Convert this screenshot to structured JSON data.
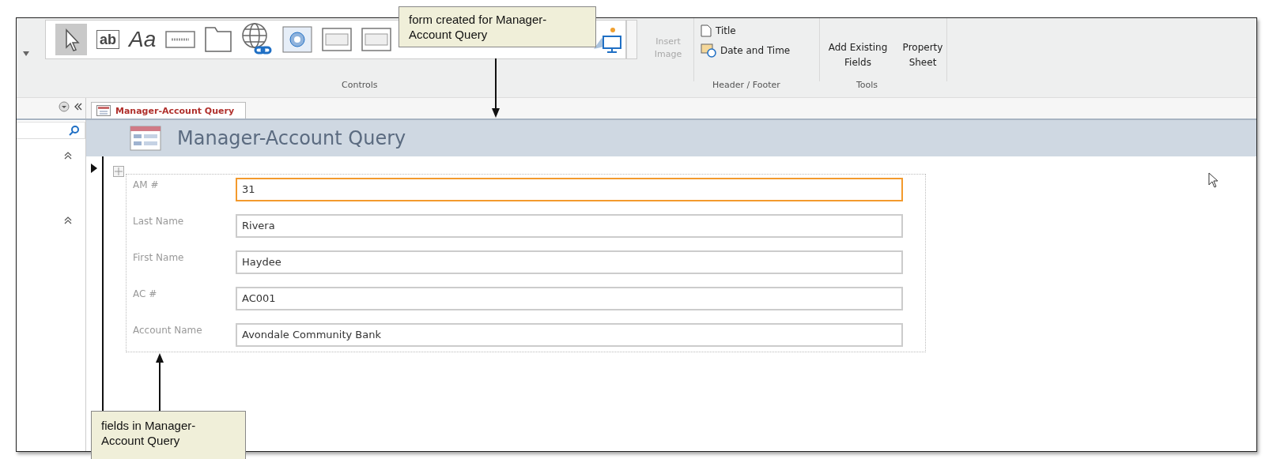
{
  "ribbon": {
    "controls_gallery": [
      {
        "kind": "pointer"
      },
      {
        "kind": "textbox",
        "glyph": "ab"
      },
      {
        "kind": "label",
        "glyph": "Aa"
      },
      {
        "kind": "button"
      },
      {
        "kind": "tab"
      },
      {
        "kind": "hyperlink"
      },
      {
        "kind": "browser"
      },
      {
        "kind": "navigation"
      },
      {
        "kind": "navigation"
      },
      {
        "kind": "image"
      }
    ],
    "insert_image": {
      "label": "Insert Image",
      "disabled": true
    },
    "groups": [
      {
        "label": "Controls"
      },
      {
        "label": "Header / Footer",
        "items": [
          {
            "kind": "title",
            "label": "Title"
          },
          {
            "kind": "datetime",
            "label": "Date and Time"
          }
        ]
      },
      {
        "label": "Tools",
        "items": [
          {
            "kind": "fields",
            "label": "Add Existing Fields"
          },
          {
            "kind": "sheet",
            "label": "Property Sheet"
          }
        ]
      }
    ]
  },
  "document_tab": {
    "label": "Manager-Account Query",
    "selected": true
  },
  "form": {
    "title": "Manager-Account Query",
    "fields": [
      {
        "label": "AM #",
        "value": "31",
        "focused": true
      },
      {
        "label": "Last Name",
        "value": "Rivera",
        "focused": false
      },
      {
        "label": "First Name",
        "value": "Haydee",
        "focused": false
      },
      {
        "label": "AC #",
        "value": "AC001",
        "focused": false
      },
      {
        "label": "Account Name",
        "value": "Avondale Community Bank",
        "focused": false
      }
    ]
  },
  "top_callout": {
    "text": "form created for Manager-Account Query"
  },
  "bottom_callout": {
    "text": "fields in Manager-Account Query"
  }
}
